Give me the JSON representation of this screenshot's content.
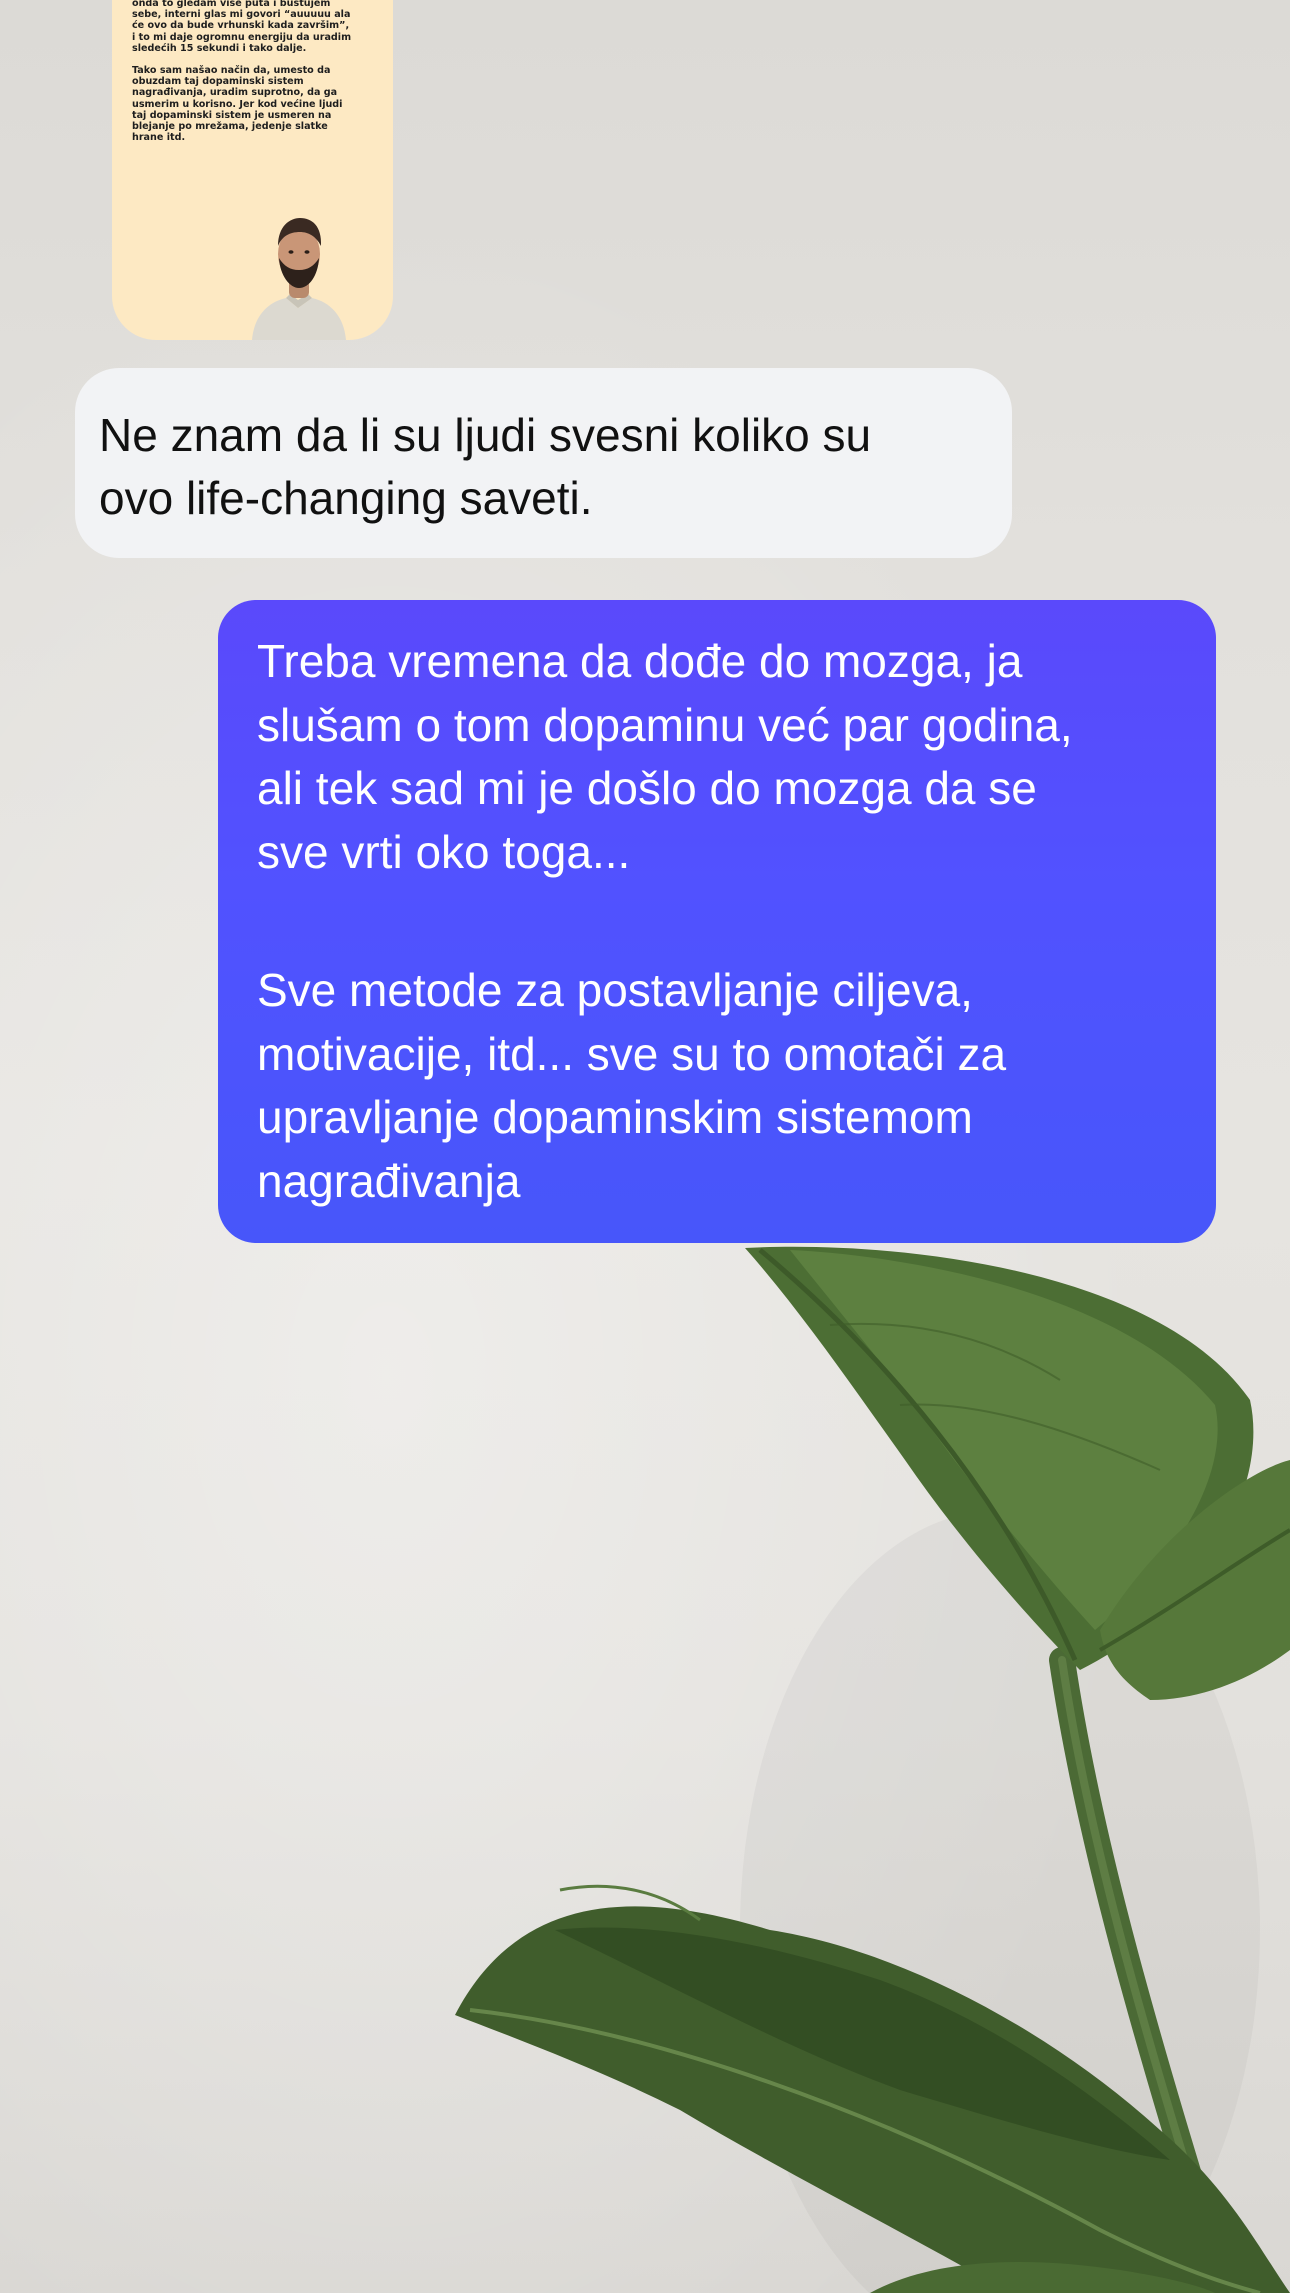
{
  "story_card": {
    "paragraph_1": "onda to gledam više puta i bustujem\nsebe, interni glas mi govori “auuuuu ala\nće ovo da bude vrhunski kada završim”,\ni to mi daje ogromnu energiju da uradim\nsledećih 15 sekundi i tako dalje.",
    "paragraph_2": "Tako sam našao način da, umesto da\nobuzdam taj dopaminski sistem\nnagrađivanja, uradim suprotno, da ga\nusmerim u korisno. Jer kod većine ljudi\ntaj dopaminski sistem je usmeren na\nblejanje po mrežama, jedenje slatke\nhrane itd.",
    "avatar_icon": "person-avatar-icon",
    "background_color": "#fde9c3"
  },
  "messages": {
    "received": {
      "text": "Ne znam da li su ljudi svesni koliko su\novo life-changing saveti.",
      "background_color": "#f2f3f5"
    },
    "sent": {
      "paragraph_1": "Treba vremena da dođe do mozga, ja\nslušam o tom dopaminu već par godina,\nali tek sad mi je došlo do mozga da se\nsve vrti oko toga...",
      "paragraph_2": "Sve metode za postavljanje ciljeva,\nmotivacije, itd... sve su to omotači za\nupravljanje dopaminskim sistemom\nnagrađivanja",
      "background_color": "#5152ff"
    }
  },
  "background": {
    "decoration_icon": "plant-leaves-icon"
  }
}
